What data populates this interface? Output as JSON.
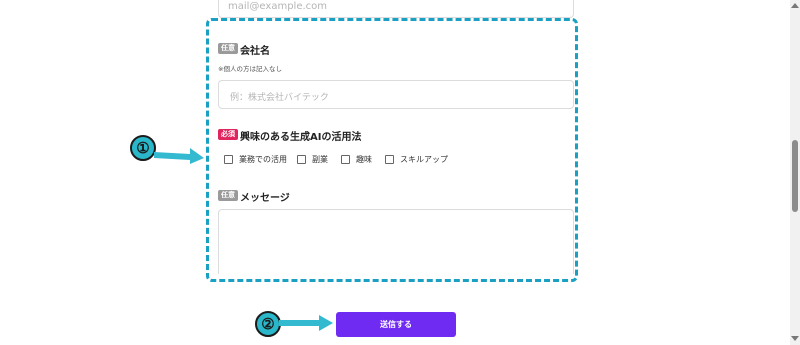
{
  "form": {
    "email_placeholder": "mail@example.com",
    "company": {
      "tag": "任意",
      "label": "会社名",
      "note": "※個人の方は記入なし",
      "placeholder": "例：株式会社バイテック"
    },
    "interest": {
      "tag": "必須",
      "label": "興味のある生成AIの活用法",
      "options": [
        "業務での活用",
        "副業",
        "趣味",
        "スキルアップ"
      ]
    },
    "message": {
      "tag": "任意",
      "label": "メッセージ"
    },
    "submit_label": "送信する"
  },
  "annotations": {
    "step1": "①",
    "step2": "②"
  },
  "colors": {
    "accent": "#6f2bf2",
    "dash": "#1aa0c2",
    "required": "#e0245e",
    "optional": "#9a9a9a"
  }
}
